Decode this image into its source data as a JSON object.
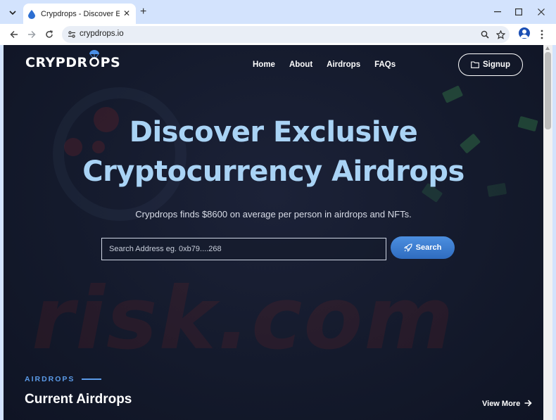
{
  "browser": {
    "tab_title": "Crypdrops - Discover Exclusive",
    "url": "crypdrops.io",
    "icons": {
      "tab_menu": "chevron-down-icon",
      "tab_close": "close-icon",
      "new_tab": "plus-icon",
      "back": "back-arrow-icon",
      "forward": "forward-arrow-icon",
      "reload": "reload-icon",
      "site_info": "site-info-icon",
      "zoom": "search-icon",
      "bookmark": "star-icon",
      "profile": "profile-icon",
      "menu": "kebab-icon"
    }
  },
  "header": {
    "logo": "CRYPDROPS",
    "logo_left": "CRYPDR",
    "logo_right": "PS",
    "nav": [
      "Home",
      "About",
      "Airdrops",
      "FAQs"
    ],
    "signup_label": "Signup"
  },
  "hero": {
    "title_line1": "Discover Exclusive",
    "title_line2": "Cryptocurrency Airdrops",
    "subtitle": "Crypdrops finds $8600 on average per person in airdrops and NFTs.",
    "search_placeholder": "Search Address eg. 0xb79....268",
    "search_button": "Search"
  },
  "airdrops": {
    "eyebrow": "AIRDROPS",
    "title": "Current Airdrops",
    "view_more": "View More"
  },
  "watermark": "risk.com",
  "colors": {
    "chrome": "#d3e3fd",
    "page_bg": "#141a2c",
    "hero_title": "#a9d3f5",
    "accent": "#5b9be8",
    "button": "#3a7bd0"
  }
}
